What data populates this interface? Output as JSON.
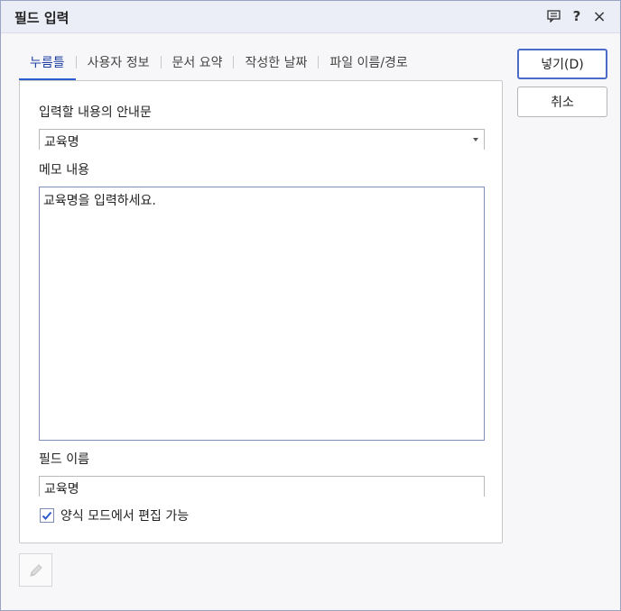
{
  "dialog": {
    "title": "필드 입력"
  },
  "titlebar_icons": {
    "memo": "comment-icon",
    "help": "?",
    "close": "×"
  },
  "tabs": [
    {
      "label": "누름틀"
    },
    {
      "label": "사용자 정보"
    },
    {
      "label": "문서 요약"
    },
    {
      "label": "작성한 날짜"
    },
    {
      "label": "파일 이름/경로"
    }
  ],
  "form": {
    "guide_label": "입력할 내용의 안내문",
    "guide_value": "교육명",
    "memo_label": "메모 내용",
    "memo_value": "교육명을 입력하세요.",
    "field_name_label": "필드 이름",
    "field_name_value": "교육명",
    "editable_label": "양식 모드에서 편집 가능",
    "editable_checked": true
  },
  "buttons": {
    "insert_label": "넣기(D)",
    "cancel_label": "취소"
  },
  "colors": {
    "accent": "#2f5bd0",
    "titlebar": "#ebedf7"
  }
}
